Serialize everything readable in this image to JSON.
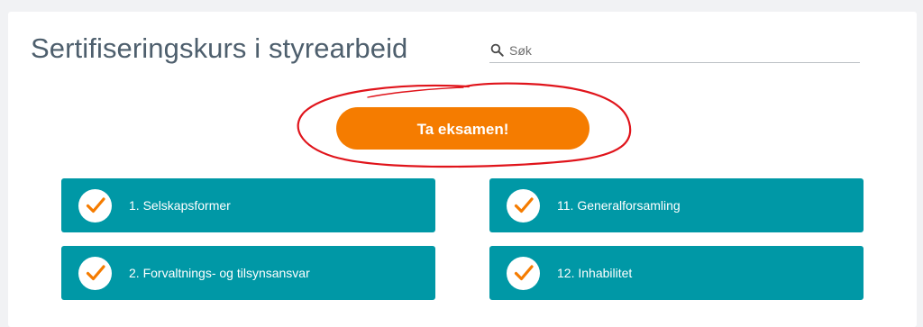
{
  "page": {
    "title": "Sertifiseringskurs i styrearbeid"
  },
  "search": {
    "placeholder": "Søk",
    "icon": "search-icon"
  },
  "exam_button": {
    "label": "Ta eksamen!",
    "color": "#f57c00"
  },
  "annotation": {
    "color": "#e0141b"
  },
  "modules": [
    {
      "label": "1. Selskapsformer",
      "completed": true
    },
    {
      "label": "11. Generalforsamling",
      "completed": true
    },
    {
      "label": "2. Forvaltnings- og tilsynsansvar",
      "completed": true
    },
    {
      "label": "12. Inhabilitet",
      "completed": true
    }
  ],
  "colors": {
    "module_bg": "#0098a6",
    "check_icon": "#f57c00",
    "title_text": "#4e5f6d"
  }
}
